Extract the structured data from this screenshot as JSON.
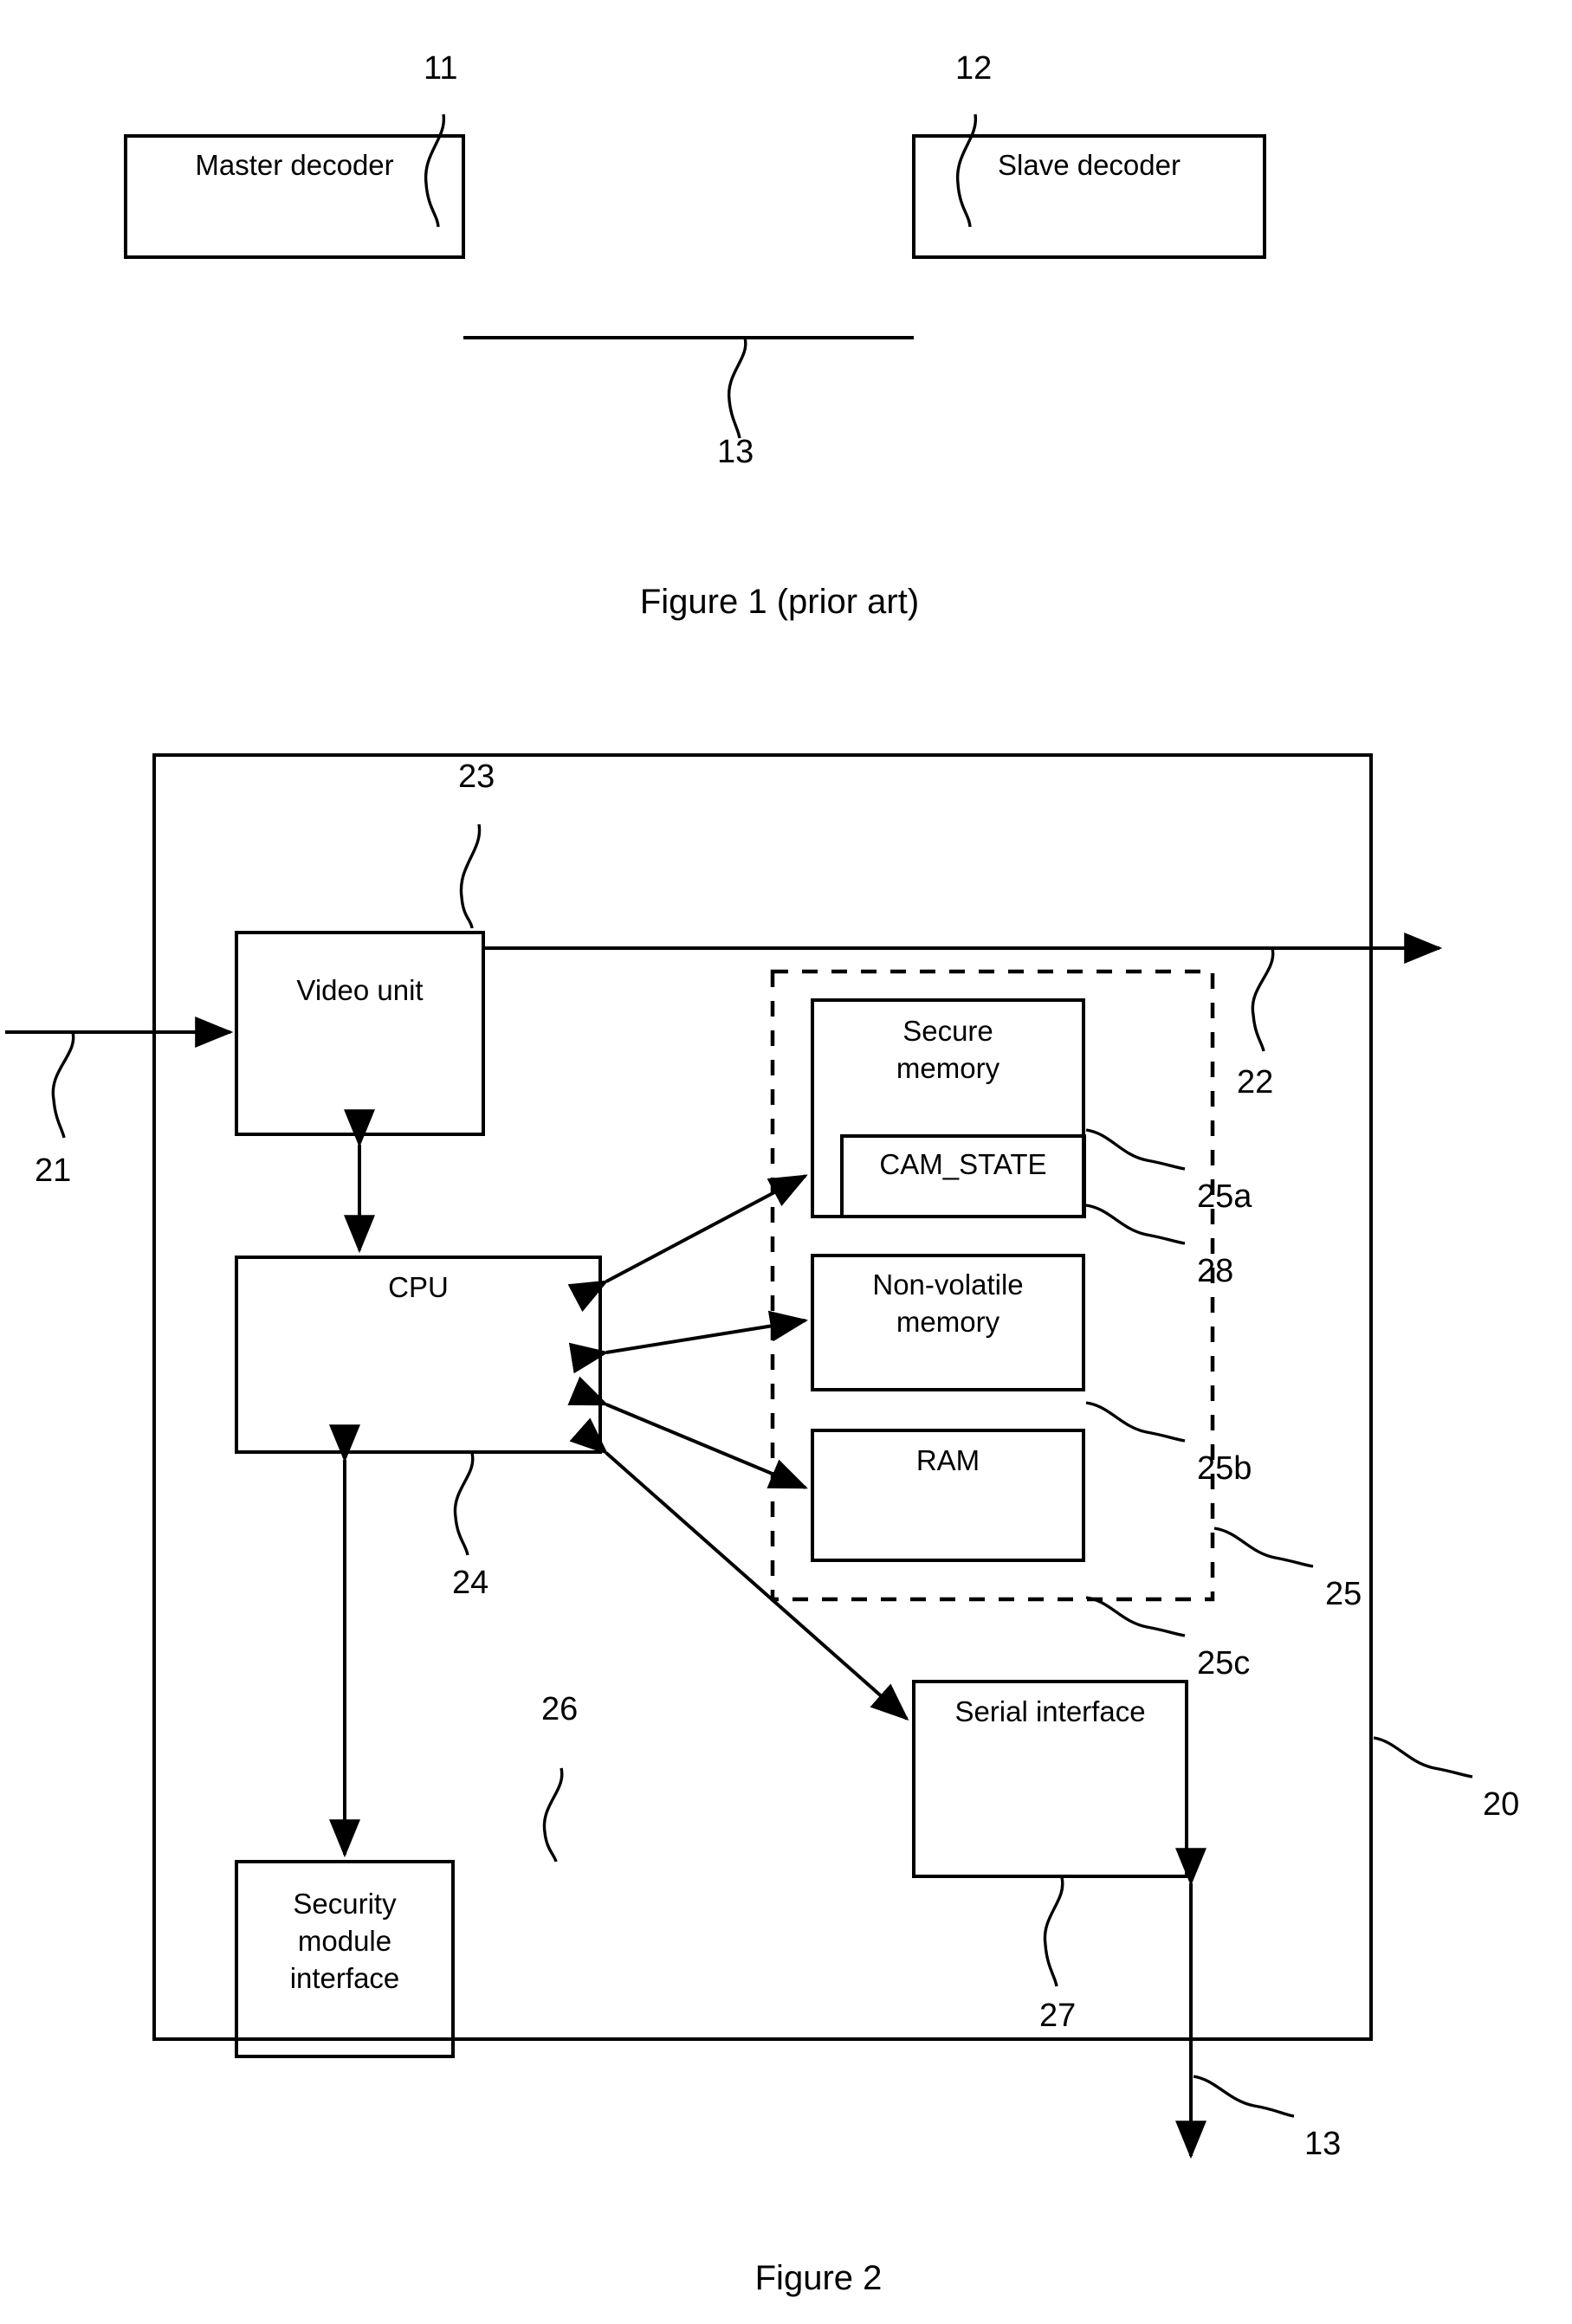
{
  "document": {
    "type": "patent-figure-sheet",
    "figures": [
      {
        "id": "figure-1",
        "caption": "Figure 1 (prior art)",
        "blocks": [
          {
            "id": "master-decoder",
            "label": "Master decoder",
            "ref": "11"
          },
          {
            "id": "slave-decoder",
            "label": "Slave decoder",
            "ref": "12"
          }
        ],
        "connections": [
          {
            "id": "link-13",
            "ref": "13",
            "from": "master-decoder",
            "to": "slave-decoder"
          }
        ]
      },
      {
        "id": "figure-2",
        "caption": "Figure 2",
        "outer_ref": "20",
        "blocks": [
          {
            "id": "video-unit",
            "label": "Video unit",
            "ref": "23"
          },
          {
            "id": "cpu",
            "label": "CPU",
            "ref": "24"
          },
          {
            "id": "secure-memory",
            "label": "Secure\nmemory",
            "ref": "25a"
          },
          {
            "id": "cam-state",
            "label": "CAM_STATE",
            "ref": "28"
          },
          {
            "id": "non-volatile-memory",
            "label": "Non-volatile\nmemory",
            "ref": "25b"
          },
          {
            "id": "ram",
            "label": "RAM",
            "ref": "25c"
          },
          {
            "id": "memory-group",
            "label": "",
            "ref": "25"
          },
          {
            "id": "serial-interface",
            "label": "Serial interface",
            "ref": "27"
          },
          {
            "id": "security-module-interface",
            "label": "Security\nmodule\ninterface",
            "ref": "26"
          }
        ],
        "signals": [
          {
            "id": "input-signal",
            "ref": "21"
          },
          {
            "id": "output-signal",
            "ref": "22"
          },
          {
            "id": "serial-link",
            "ref": "13"
          }
        ]
      }
    ]
  },
  "refs": {
    "r11": "11",
    "r12": "12",
    "r13a": "13",
    "r13b": "13",
    "r20": "20",
    "r21": "21",
    "r22": "22",
    "r23": "23",
    "r24": "24",
    "r25": "25",
    "r25a": "25a",
    "r25b": "25b",
    "r25c": "25c",
    "r26": "26",
    "r27": "27",
    "r28": "28"
  },
  "labels": {
    "master_decoder": "Master decoder",
    "slave_decoder": "Slave decoder",
    "video_unit": "Video unit",
    "cpu": "CPU",
    "secure_memory_l1": "Secure",
    "secure_memory_l2": "memory",
    "cam_state": "CAM_STATE",
    "nonvolatile_l1": "Non-volatile",
    "nonvolatile_l2": "memory",
    "ram": "RAM",
    "serial_interface": "Serial interface",
    "security_l1": "Security",
    "security_l2": "module",
    "security_l3": "interface"
  },
  "captions": {
    "figure1": "Figure 1 (prior art)",
    "figure2": "Figure 2"
  },
  "colors": {
    "ink": "#000000",
    "paper": "#ffffff"
  }
}
